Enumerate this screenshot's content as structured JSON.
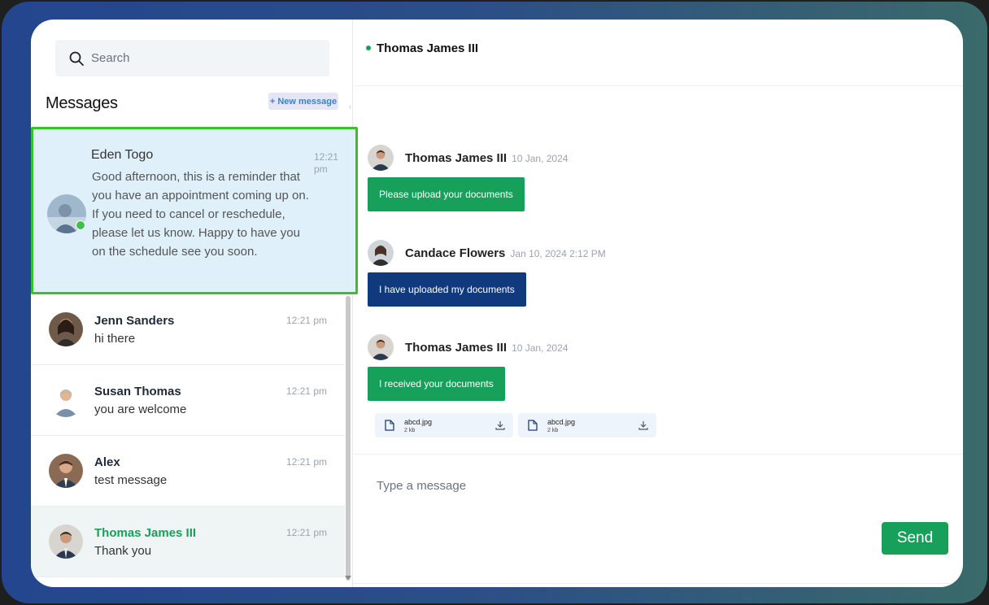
{
  "search": {
    "placeholder": "Search"
  },
  "sidebar": {
    "title": "Messages",
    "new_message_label": "+ New message",
    "selected": {
      "name": "Eden Togo",
      "preview": "Good afternoon, this is a reminder that you have an appointment coming up on. If you need to cancel or reschedule, please let us know. Happy to have you on the schedule see you soon.",
      "time": "12:21 pm"
    },
    "conversations": [
      {
        "name": "Jenn Sanders",
        "preview": "hi there",
        "time": "12:21 pm"
      },
      {
        "name": "Susan Thomas",
        "preview": "you are welcome",
        "time": "12:21 pm"
      },
      {
        "name": "Alex",
        "preview": "test message",
        "time": "12:21 pm"
      },
      {
        "name": "Thomas James III",
        "preview": "Thank you",
        "time": "12:21 pm"
      }
    ]
  },
  "chat": {
    "header_name": "Thomas James III",
    "messages": [
      {
        "sender": "Thomas James III",
        "date": "10 Jan, 2024",
        "text": "Please upload your documents"
      },
      {
        "sender": "Candace Flowers",
        "date": "Jan 10, 2024 2:12 PM",
        "text": "I have uploaded my documents"
      },
      {
        "sender": "Thomas James III",
        "date": "10 Jan, 2024",
        "text": "I received your documents"
      }
    ],
    "attachments": [
      {
        "name": "abcd.jpg",
        "size": "2 kb"
      },
      {
        "name": "abcd.jpg",
        "size": "2 kb"
      }
    ]
  },
  "composer": {
    "placeholder": "Type a message",
    "send_label": "Send"
  },
  "colors": {
    "accent_green": "#16a05a",
    "navy": "#103a7d",
    "selected_border": "#36c228"
  }
}
